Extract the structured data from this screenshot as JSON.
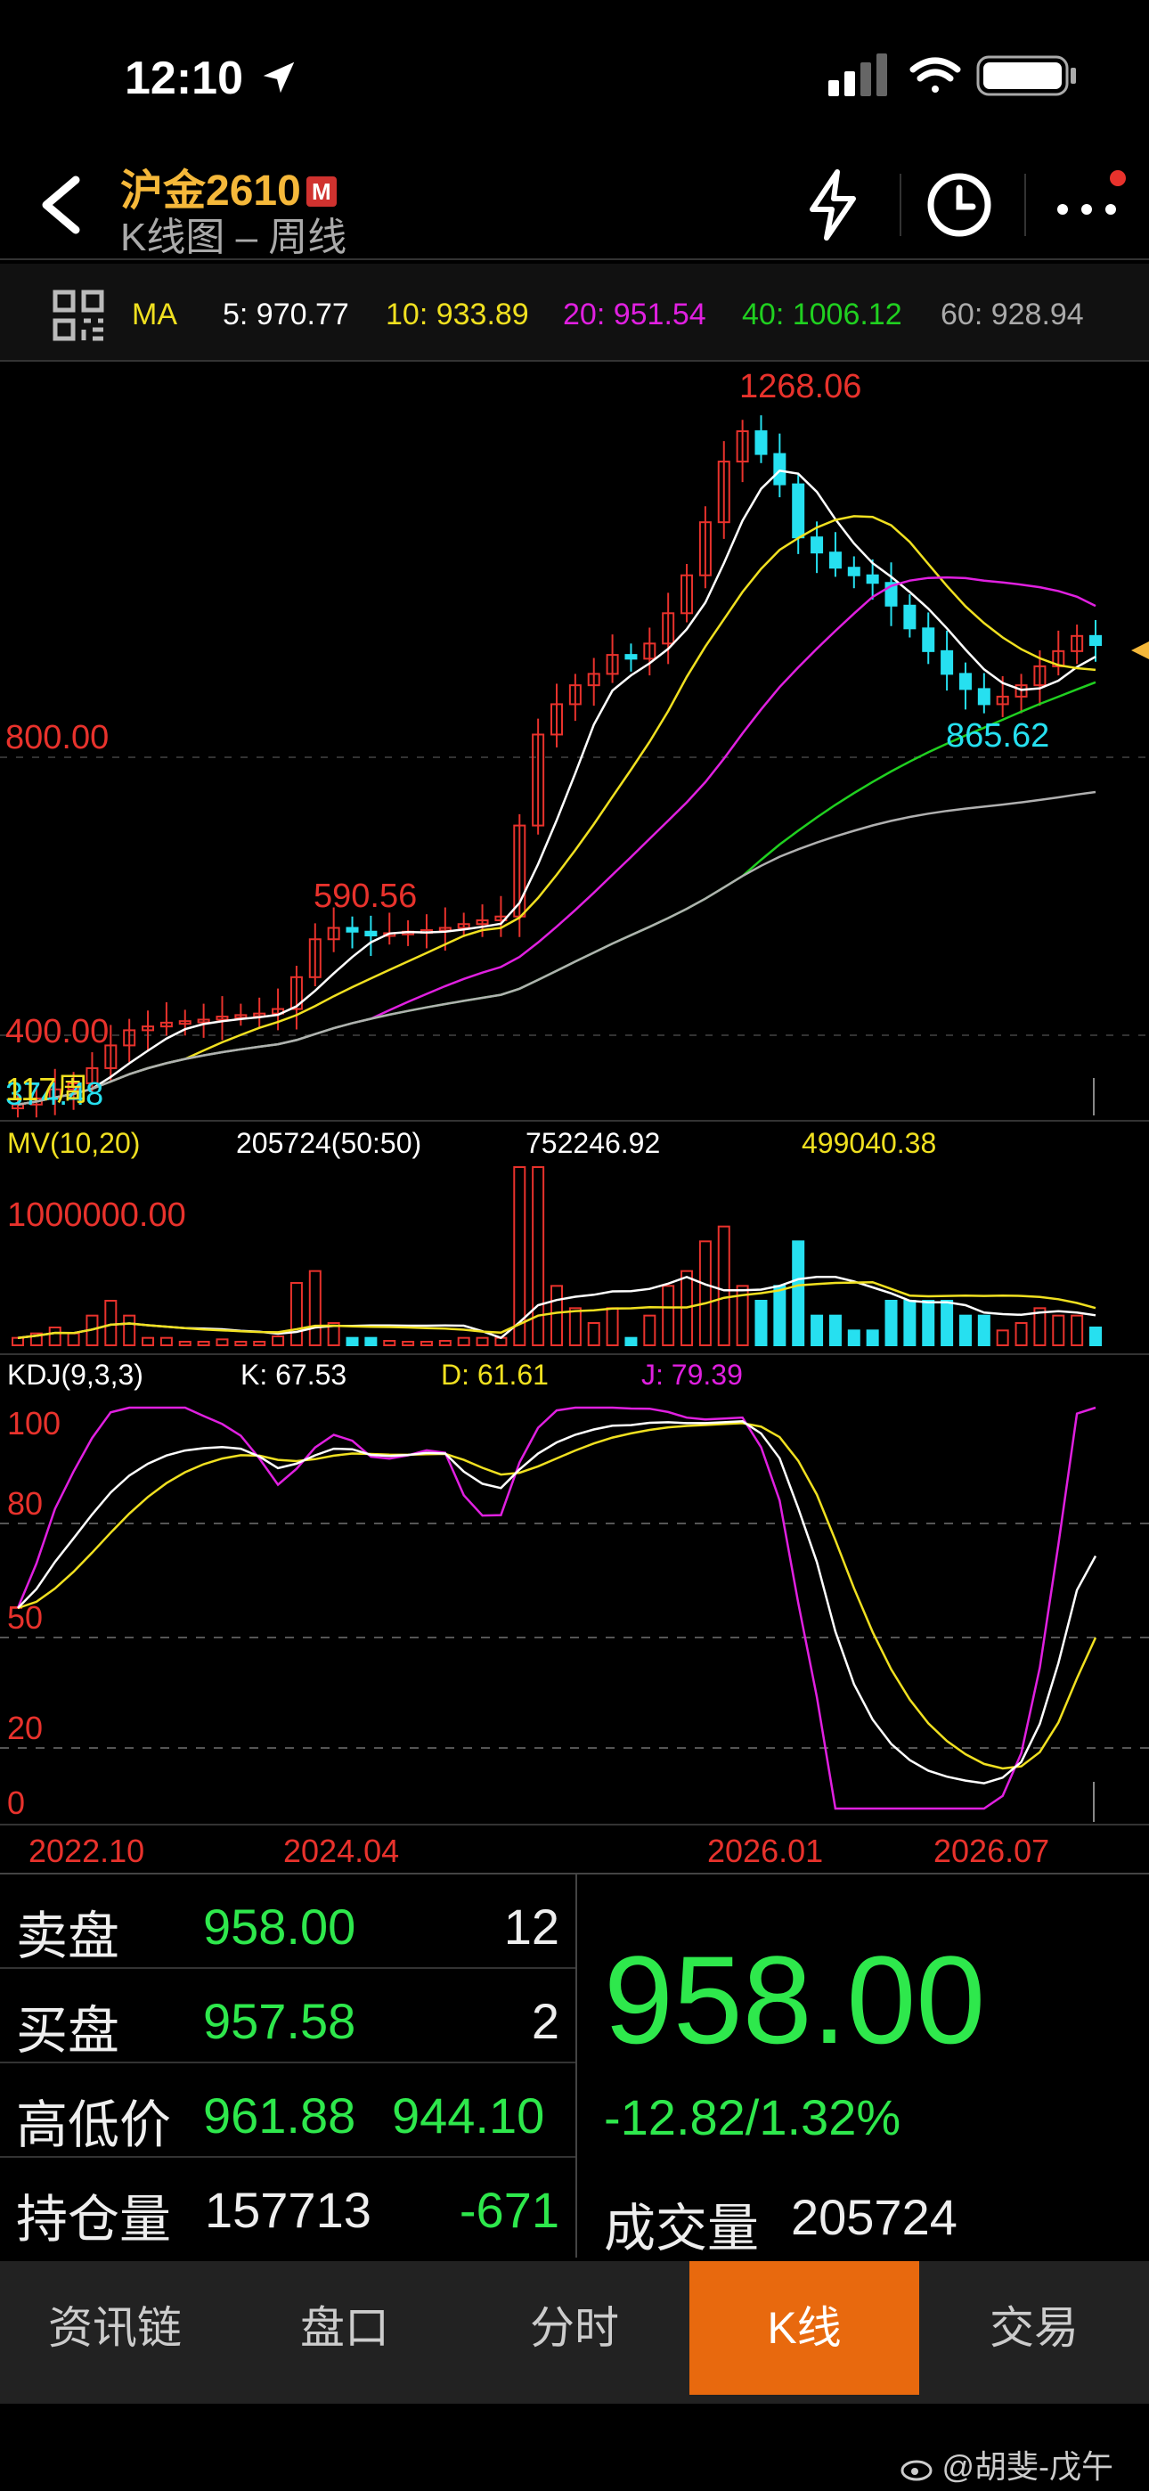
{
  "status": {
    "time": "12:10"
  },
  "header": {
    "title": "沪金2610",
    "badge": "M",
    "subtitle": "K线图 – 周线"
  },
  "ma": {
    "label": "MA",
    "ma5": "5: 970.77",
    "ma10": "10: 933.89",
    "ma20": "20: 951.54",
    "ma40": "40: 1006.12",
    "ma60": "60: 928.94"
  },
  "colors": {
    "up": "#e8322c",
    "down": "#26e0f0",
    "ma5": "#ffffff",
    "ma10": "#f0e020",
    "ma20": "#e020e0",
    "ma40": "#20d020",
    "ma60": "#b0b0b0",
    "green": "#2ee84c",
    "active_tab": "#e8690e"
  },
  "price_chart": {
    "high_label": "1268.06",
    "low_label": "865.62",
    "left_label": "590.56",
    "axis_800": "800.00",
    "axis_400": "400.00",
    "week_label": "117周",
    "overlap_label": "374.48"
  },
  "volume_chart": {
    "label": "MV(10,20)",
    "vol": "205724(50:50)",
    "mv10": "752246.92",
    "mv20": "499040.38",
    "axis_label": "1000000.00"
  },
  "kdj": {
    "label": "KDJ(9,3,3)",
    "k": "K: 67.53",
    "d": "D: 61.61",
    "j": "J: 79.39",
    "ticks": [
      "100",
      "80",
      "50",
      "20",
      "0"
    ]
  },
  "dates": [
    "2022.10",
    "2024.04",
    "2026.01",
    "2026.07"
  ],
  "quote": {
    "sell_label": "卖盘",
    "sell_price": "958.00",
    "sell_vol": "12",
    "buy_label": "买盘",
    "buy_price": "957.58",
    "buy_vol": "2",
    "hl_label": "高低价",
    "high": "961.88",
    "low": "944.10",
    "oi_label": "持仓量",
    "oi": "157713",
    "oi_change": "-671",
    "last_price": "958.00",
    "change": "-12.82/1.32%",
    "turnover_label": "成交量",
    "turnover": "205724"
  },
  "tabs": [
    {
      "label": "资讯链",
      "active": false
    },
    {
      "label": "盘口",
      "active": false
    },
    {
      "label": "分时",
      "active": false
    },
    {
      "label": "K线",
      "active": true
    },
    {
      "label": "交易",
      "active": false
    }
  ],
  "watermark": "@胡斐-戊午",
  "icons": [
    "location-arrow-icon",
    "signal-icon",
    "wifi-icon",
    "battery-icon",
    "back-icon",
    "lightning-icon",
    "clock-icon",
    "more-icon",
    "grid-icon",
    "weibo-icon"
  ],
  "chart_data": {
    "type": "line",
    "title": "",
    "candles_close": [
      352,
      360,
      372,
      380,
      400,
      430,
      450,
      455,
      460,
      462,
      464,
      468,
      470,
      472,
      478,
      520,
      570,
      585,
      580,
      575,
      578,
      580,
      582,
      585,
      590,
      595,
      600,
      720,
      840,
      880,
      905,
      920,
      945,
      940,
      960,
      1000,
      1050,
      1120,
      1200,
      1240,
      1210,
      1170,
      1100,
      1080,
      1060,
      1050,
      1040,
      1010,
      980,
      950,
      920,
      900,
      880,
      890,
      905,
      930,
      950,
      970,
      958
    ],
    "price_range": [
      340,
      1280
    ],
    "kdj_range": [
      0,
      100
    ],
    "x_ticks": [
      "2022.10",
      "2024.04",
      "2026.01",
      "2026.07"
    ]
  }
}
